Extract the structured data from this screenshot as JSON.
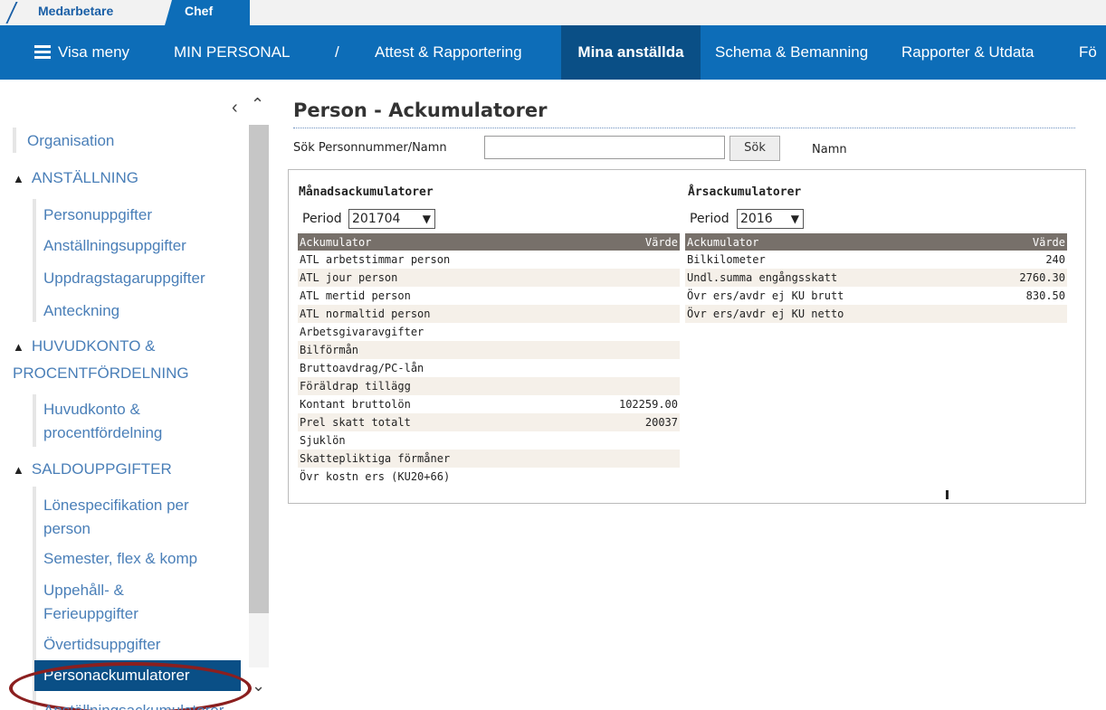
{
  "roles": {
    "inactive": "Medarbetare",
    "active": "Chef"
  },
  "nav": {
    "menu_label": "Visa meny",
    "app_title": "MIN PERSONAL",
    "separator": "/",
    "items": [
      "Attest & Rapportering",
      "Mina anställda",
      "Schema & Bemanning",
      "Rapporter & Utdata",
      "Fö"
    ],
    "active_index": 1
  },
  "sidebar": {
    "collapse_icon": "chevron-left-icon",
    "top_item": "Organisation",
    "sections": [
      {
        "title": "ANSTÄLLNING",
        "items": [
          "Personuppgifter",
          "Anställningsuppgifter",
          "Uppdragstagaruppgifter",
          "Anteckning"
        ]
      },
      {
        "title_lines": [
          "HUVUDKONTO &",
          "PROCENTFÖRDELNING"
        ],
        "items": [
          "Huvudkonto & procentfördelning"
        ]
      },
      {
        "title": "SALDOUPPGIFTER",
        "items": [
          "Lönespecifikation per person",
          "Semester, flex & komp",
          "Uppehåll- & Ferieuppgifter",
          "Övertidsuppgifter"
        ]
      }
    ],
    "item_lines": {
      "huvud": [
        "Huvudkonto &",
        "procentfördelning"
      ],
      "lonespec": [
        "Lönespecifikation per",
        "person"
      ],
      "uppehall": [
        "Uppehåll- &",
        "Ferieuppgifter"
      ]
    },
    "active_item": "Personackumulatorer",
    "cut_item": "Anställningsackumulatorer"
  },
  "page": {
    "title": "Person - Ackumulatorer",
    "search_label": "Sök Personnummer/Namn",
    "search_value": "",
    "search_button": "Sök",
    "name_label": "Namn"
  },
  "monthly": {
    "title": "Månadsackumulatorer",
    "period_label": "Period",
    "period_value": "201704",
    "col_name": "Ackumulator",
    "col_value": "Värde",
    "rows": [
      {
        "name": "ATL arbetstimmar person",
        "value": ""
      },
      {
        "name": "ATL jour person",
        "value": ""
      },
      {
        "name": "ATL mertid person",
        "value": ""
      },
      {
        "name": "ATL normaltid person",
        "value": ""
      },
      {
        "name": "Arbetsgivaravgifter",
        "value": ""
      },
      {
        "name": "Bilförmån",
        "value": ""
      },
      {
        "name": "Bruttoavdrag/PC-lån",
        "value": ""
      },
      {
        "name": "Föräldrap tillägg",
        "value": ""
      },
      {
        "name": "Kontant bruttolön",
        "value": "102259.00"
      },
      {
        "name": "Prel skatt totalt",
        "value": "20037"
      },
      {
        "name": "Sjuklön",
        "value": ""
      },
      {
        "name": "Skattepliktiga förmåner",
        "value": ""
      },
      {
        "name": "Övr kostn ers (KU20+66)",
        "value": ""
      }
    ]
  },
  "yearly": {
    "title": "Årsackumulatorer",
    "period_label": "Period",
    "period_value": "2016",
    "col_name": "Ackumulator",
    "col_value": "Värde",
    "rows": [
      {
        "name": "Bilkilometer",
        "value": "240"
      },
      {
        "name": "Undl.summa engångsskatt",
        "value": "2760.30"
      },
      {
        "name": "Övr ers/avdr ej KU brutt",
        "value": "830.50"
      },
      {
        "name": "Övr ers/avdr ej KU netto",
        "value": ""
      }
    ]
  },
  "colors": {
    "brand": "#0d6db8",
    "nav_active": "#0a4f86",
    "table_header": "#77706a",
    "highlight": "#8b1f1f",
    "link": "#4a7fb8"
  }
}
